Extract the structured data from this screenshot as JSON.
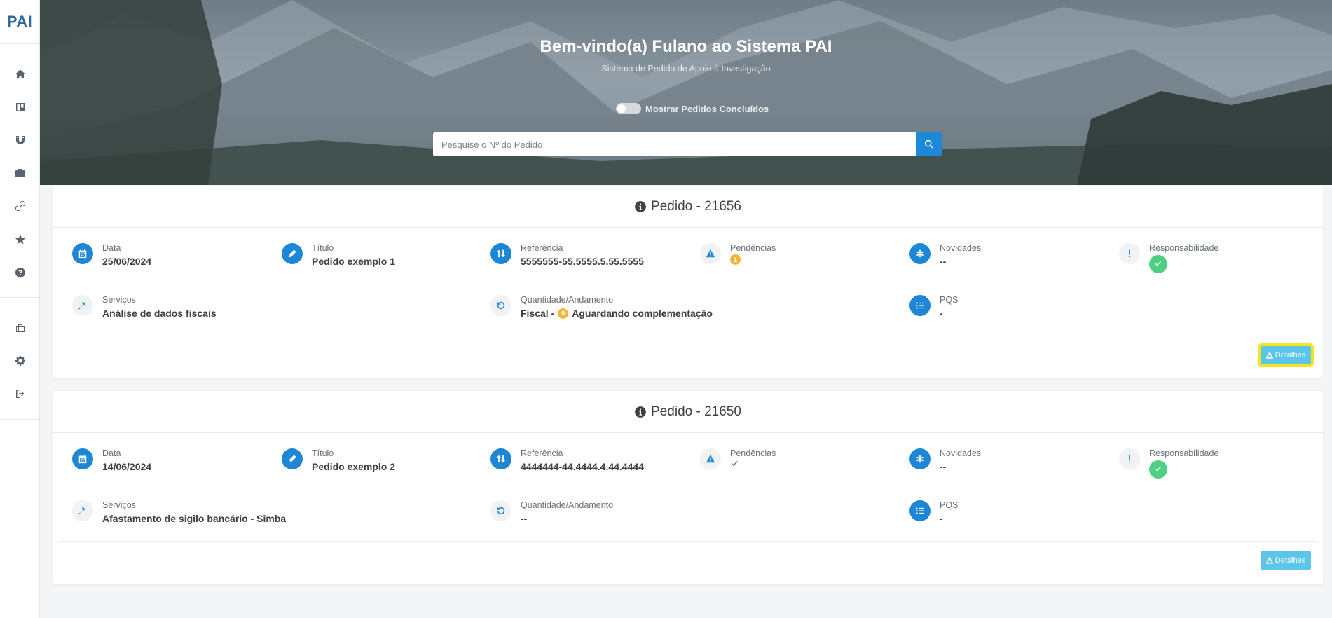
{
  "brand": "PAI",
  "sidebar": {
    "items_top": [
      {
        "icon": "home-icon",
        "name": "nav-home"
      },
      {
        "icon": "board-icon",
        "name": "nav-board"
      },
      {
        "icon": "magnet-icon",
        "name": "nav-magnet"
      },
      {
        "icon": "briefcase-icon",
        "name": "nav-briefcase"
      },
      {
        "icon": "link-icon",
        "name": "nav-links"
      },
      {
        "icon": "star-icon",
        "name": "nav-favorites"
      },
      {
        "icon": "help-icon",
        "name": "nav-help"
      }
    ],
    "items_bottom": [
      {
        "icon": "institution-icon",
        "name": "nav-institution"
      },
      {
        "icon": "gear-icon",
        "name": "nav-settings"
      },
      {
        "icon": "logout-icon",
        "name": "nav-logout"
      }
    ]
  },
  "hero": {
    "title": "Bem-vindo(a) Fulano ao Sistema PAI",
    "subtitle": "Sistema de Pedido de Apoio à Investigação",
    "toggle_label": "Mostrar Pedidos Concluídos",
    "toggle_on": false,
    "search_placeholder": "Pesquise o Nº do Pedido"
  },
  "labels": {
    "data": "Data",
    "titulo": "Título",
    "referencia": "Referência",
    "pendencias": "Pendências",
    "novidades": "Novidades",
    "responsabilidade": "Responsabilidade",
    "servicos": "Serviços",
    "quantidade": "Quantidade/Andamento",
    "pqs": "PQS",
    "detalhes": "Detalhes"
  },
  "pedidos": [
    {
      "title": "Pedido - 21656",
      "data": "25/06/2024",
      "titulo": "Pedido exemplo 1",
      "referencia": "5555555-55.5555.5.55.5555",
      "pendencias_badge": "1",
      "novidades": "--",
      "servicos": "Análise de dados fiscais",
      "quantidade_prefix": "Fiscal -",
      "quantidade_badge": "0",
      "quantidade_status": "Aguardando complementação",
      "pqs": "-"
    },
    {
      "title": "Pedido - 21650",
      "data": "14/06/2024",
      "titulo": "Pedido exemplo 2",
      "referencia": "4444444-44.4444.4.44.4444",
      "novidades": "--",
      "servicos": "Afastamento de sigilo bancário - Simba",
      "quantidade_text": "--",
      "pqs": "-"
    }
  ],
  "colors": {
    "primary": "#1d86d5",
    "success": "#4fcf81",
    "warning": "#f5b53c",
    "info_button": "#5bc5ea",
    "highlight": "#f5e41b"
  }
}
